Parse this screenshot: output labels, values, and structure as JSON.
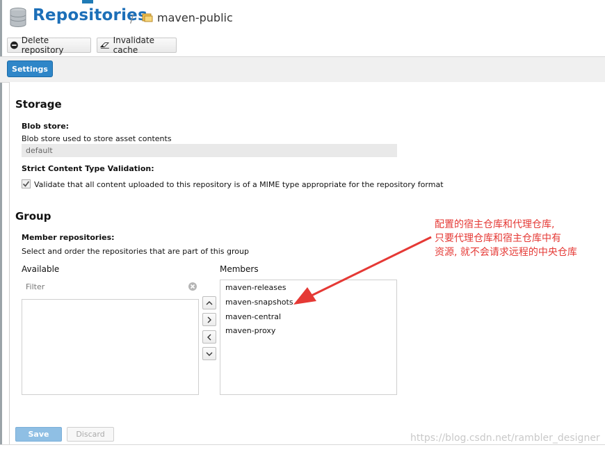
{
  "header": {
    "title": "Repositories",
    "separator": "/",
    "repo_name": "maven-public"
  },
  "toolbar": {
    "delete_label": "Delete repository",
    "invalidate_label": "Invalidate cache"
  },
  "tabs": {
    "settings_label": "Settings"
  },
  "storage": {
    "heading": "Storage",
    "blob_label": "Blob store:",
    "blob_help": "Blob store used to store asset contents",
    "blob_value": "default",
    "strict_label": "Strict Content Type Validation:",
    "strict_text": "Validate that all content uploaded to this repository is of a MIME type appropriate for the repository format",
    "strict_checked": true
  },
  "group": {
    "heading": "Group",
    "member_label": "Member repositories:",
    "member_help": "Select and order the repositories that are part of this group",
    "available_label": "Available",
    "filter_placeholder": "Filter",
    "members_label": "Members",
    "members": [
      "maven-releases",
      "maven-snapshots",
      "maven-central",
      "maven-proxy"
    ]
  },
  "footer": {
    "save_label": "Save",
    "discard_label": "Discard"
  },
  "annotation": {
    "lines": [
      "配置的宿主仓库和代理仓库,",
      "只要代理仓库和宿主仓库中有",
      "资源, 就不会请求远程的中央仓库"
    ]
  },
  "watermark": "https://blog.csdn.net/rambler_designer",
  "colors": {
    "accent": "#1c6fb8",
    "annotation": "#e53935",
    "tab": "#2f86c8"
  }
}
